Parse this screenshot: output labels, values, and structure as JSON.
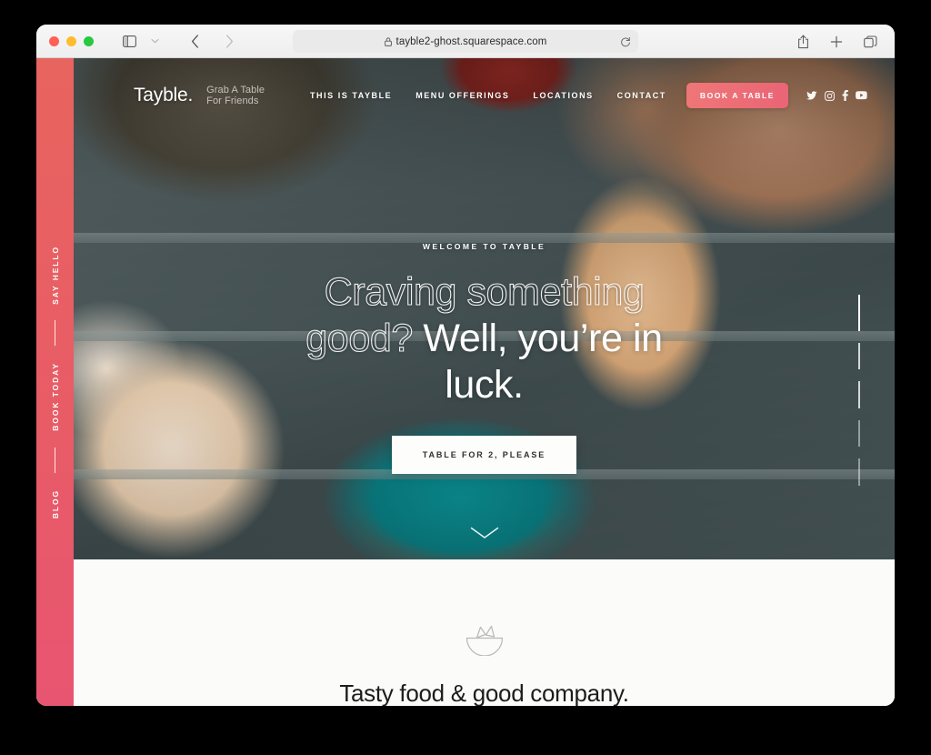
{
  "browser": {
    "url": "tayble2-ghost.squarespace.com",
    "lock_icon": "lock-icon",
    "reload_icon": "reload-icon",
    "traffic_lights": [
      "close-button",
      "minimize-button",
      "zoom-button"
    ],
    "toolbar_left": [
      {
        "name": "sidebar-toggle-button",
        "icon": "sidebar-icon"
      },
      {
        "name": "sidebar-dropdown-button",
        "icon": "chevron-down-icon"
      },
      {
        "name": "back-button",
        "icon": "chevron-left-icon"
      },
      {
        "name": "forward-button",
        "icon": "chevron-right-icon"
      }
    ],
    "toolbar_right": [
      {
        "name": "share-button",
        "icon": "share-icon"
      },
      {
        "name": "new-tab-button",
        "icon": "plus-icon"
      },
      {
        "name": "show-tabs-button",
        "icon": "tabs-icon"
      }
    ]
  },
  "side_rail": {
    "links": [
      "SAY HELLO",
      "BOOK TODAY",
      "BLOG"
    ],
    "color_top": "#E8645F",
    "color_bottom": "#E85571"
  },
  "header": {
    "logo": "Tayble.",
    "tagline": "Grab A Table For Friends",
    "nav": [
      "THIS IS TAYBLE",
      "MENU OFFERINGS",
      "LOCATIONS",
      "CONTACT"
    ],
    "cta_label": "BOOK A TABLE",
    "cta_color": "#EA6476",
    "social": [
      "twitter-icon",
      "instagram-icon",
      "facebook-icon",
      "youtube-icon"
    ]
  },
  "hero": {
    "eyebrow": "WELCOME TO TAYBLE",
    "headline_outline": "Craving something good?",
    "headline_solid": " Well, you’re in luck.",
    "cta_label": "TABLE FOR 2, PLEASE",
    "scroll_icon": "chevron-down-icon"
  },
  "intro": {
    "icon": "salsa-bowl-icon",
    "heading": "Tasty food & good company."
  }
}
